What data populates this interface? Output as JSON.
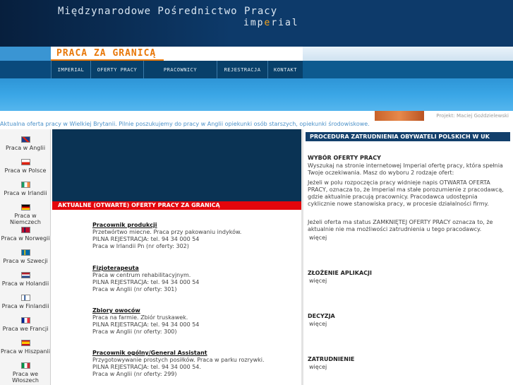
{
  "header": {
    "title": "Międzynarodowe Pośrednictwo Pracy",
    "subtitle_pre": "imp",
    "subtitle_o": "e",
    "subtitle_post": "rial",
    "logo": "PRACA ZA GRANICĄ"
  },
  "nav": [
    "IMPERIAL",
    "OFERTY PRACY",
    "PRACOWNICY",
    "REJESTRACJA",
    "KONTAKT"
  ],
  "author": "Projekt: Maciej Goździelewski",
  "ticker": "Aktualna oferta pracy w Wielkiej Brytanii. Pilnie poszukujemy do pracy w Anglii opiekunki osób starszych, opiekunki środowiskowe.",
  "countries": [
    "Praca w Anglii",
    "Praca w Polsce",
    "Praca w Irlandii",
    "Praca w Niemczech",
    "Praca w Norwegii",
    "Praca w Szwecji",
    "Praca w Holandii",
    "Praca w Finlandii",
    "Praca we Francji",
    "Praca w Hiszpanii",
    "Praca we Włoszech"
  ],
  "offers_header": "AKTUALNE (OTWARTE) OFERTY PRACY ZA GRANICĄ",
  "offers": [
    {
      "title": "Pracownik produkcji",
      "desc": "Przetwórtwo miecne. Praca przy pakowaniu indyków.",
      "phone": "PILNA REJESTRACJA: tel. 94 34 000 54",
      "loc": "Praca w Irlandii Pn (nr oferty: 302)"
    },
    {
      "title": "Fizjoterapeuta",
      "desc": "Praca w centrum rehabilitacyjnym.",
      "phone": "PILNA REJESTRACJA: tel. 94 34 000 54",
      "loc": "Praca w Anglii (nr oferty: 301)"
    },
    {
      "title": "Zbiory owoców",
      "desc": "Praca na farmie. Zbiór truskawek.",
      "phone": "PILNA REJESTRACJA: tel. 94 34 000 54",
      "loc": "Praca w Anglii (nr oferty: 300)"
    },
    {
      "title": "Pracownik ogólny/General Assistant",
      "desc": "Przygotowywanie prostych posiłków. Praca w parku rozrywki.",
      "phone": "PILNA REJESTRACJA: tel. 94 34 000 54.",
      "loc": "Praca w Anglii (nr oferty: 299)"
    }
  ],
  "right": {
    "header": "PROCEDURA ZATRUDNIENIA OBYWATELI POLSKICH W UK",
    "s1_title": "WYBÓR OFERTY PRACY",
    "s1_p1": "Wyszukaj na stronie internetowej Imperial ofertę pracy, która spełnia Twoje oczekiwania. Masz do wyboru 2 rodzaje ofert:",
    "s1_p2": "Jeżeli w polu rozpoczęcia pracy widnieje napis OTWARTA OFERTA PRACY, oznacza to, że Imperial ma stałe porozumienie z pracodawcą, gdzie aktualnie pracują pracownicy. Pracodawca udostępnia cyklicznie nowe stanowiska pracy, w procesie działalności firmy.",
    "s1_p3": "Jeżeli oferta ma status ZAMKNIĘTEJ OFERTY PRACY oznacza to, że aktualnie nie ma możliwości zatrudnienia u tego pracodawcy.",
    "more": "więcej",
    "s2_title": "ZŁOŻENIE APLIKACJI",
    "s3_title": "DECYZJA",
    "s4_title": "ZATRUDNIENIE"
  },
  "colors": {
    "header": "#0b2f5a",
    "accent": "#e8780a",
    "offers_bar": "#e4060c",
    "right_head": "#123f6b"
  }
}
